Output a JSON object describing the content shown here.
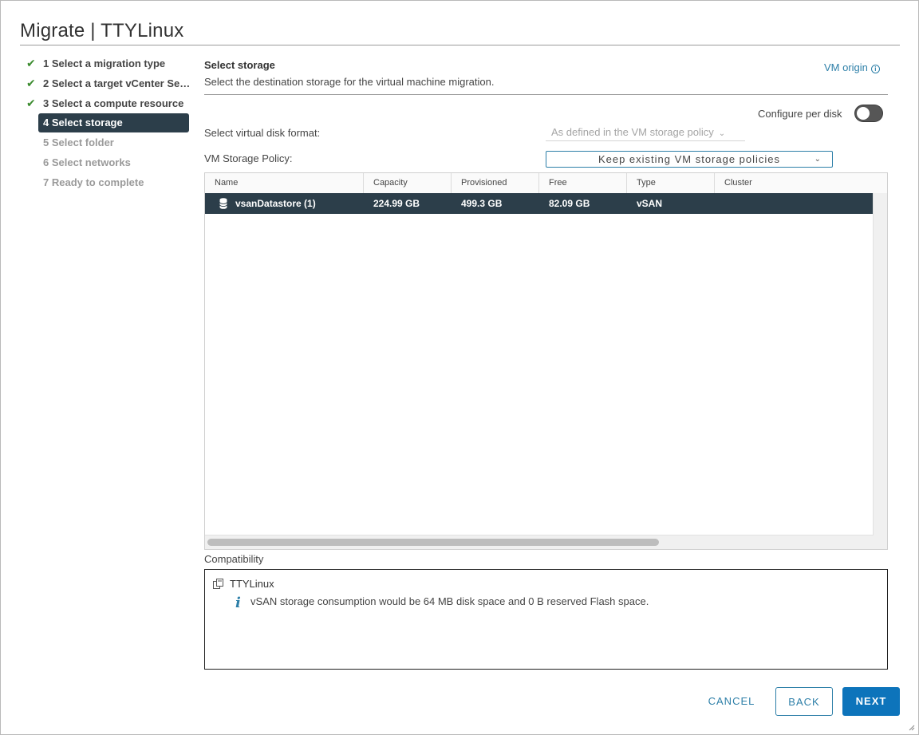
{
  "dialog": {
    "title": "Migrate | TTYLinux"
  },
  "steps": [
    {
      "label": "1 Select a migration type",
      "state": "done"
    },
    {
      "label": "2 Select a target vCenter Server",
      "state": "done"
    },
    {
      "label": "3 Select a compute resource",
      "state": "done"
    },
    {
      "label": "4 Select storage",
      "state": "current"
    },
    {
      "label": "5 Select folder",
      "state": "pending"
    },
    {
      "label": "6 Select networks",
      "state": "pending"
    },
    {
      "label": "7 Ready to complete",
      "state": "pending"
    }
  ],
  "main": {
    "section_title": "Select storage",
    "section_desc": "Select the destination storage for the virtual machine migration.",
    "vm_origin_link": "VM origin",
    "configure_per_disk_label": "Configure per disk",
    "configure_per_disk_on": false,
    "disk_format_label": "Select virtual disk format:",
    "disk_format_value": "As defined in the VM storage policy",
    "storage_policy_label": "VM Storage Policy:",
    "storage_policy_value": "Keep existing VM storage policies"
  },
  "grid": {
    "columns": [
      "Name",
      "Capacity",
      "Provisioned",
      "Free",
      "Type",
      "Cluster"
    ],
    "rows": [
      {
        "name": "vsanDatastore (1)",
        "capacity": "224.99 GB",
        "provisioned": "499.3 GB",
        "free": "82.09 GB",
        "type": "vSAN",
        "cluster": ""
      }
    ]
  },
  "compatibility": {
    "label": "Compatibility",
    "vm_name": "TTYLinux",
    "message": "vSAN storage consumption would be 64 MB disk space and 0 B reserved Flash space."
  },
  "footer": {
    "cancel": "CANCEL",
    "back": "BACK",
    "next": "NEXT"
  },
  "colors": {
    "accent": "#2d7fa8",
    "selected": "#2c3e4a",
    "primary_button": "#0d74bb",
    "check": "#3b8b2e"
  }
}
